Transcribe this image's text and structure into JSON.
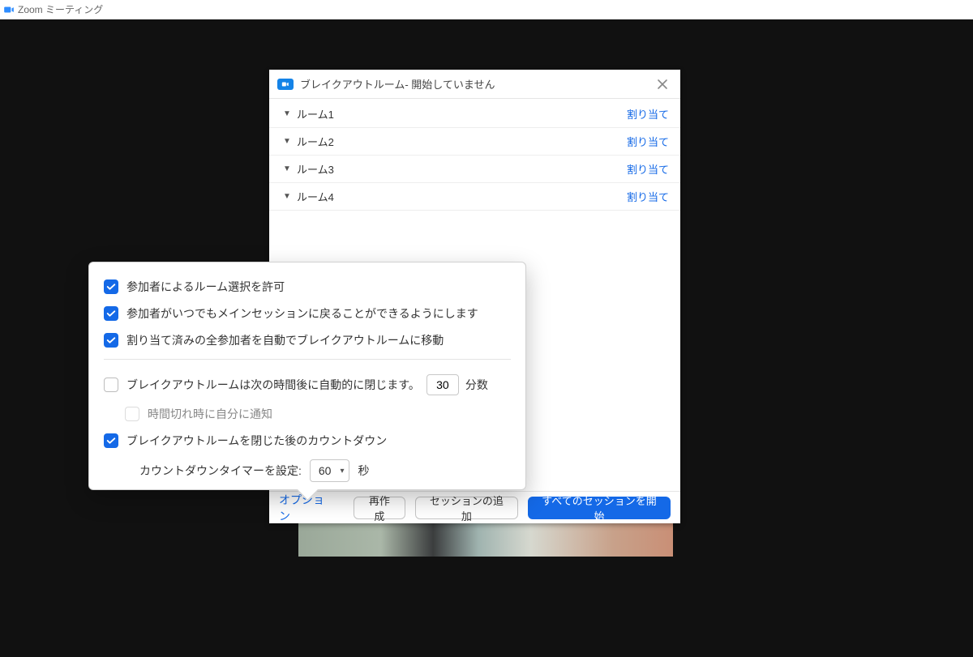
{
  "window": {
    "title": "Zoom ミーティング"
  },
  "breakout": {
    "title": "ブレイクアウトルーム- 開始していません",
    "assign_label": "割り当て",
    "rooms": [
      "ルーム1",
      "ルーム2",
      "ルーム3",
      "ルーム4"
    ],
    "footer": {
      "options": "オプション",
      "recreate": "再作成",
      "add_session": "セッションの追加",
      "start_all": "すべてのセッションを開始"
    }
  },
  "options": {
    "allow_choose": {
      "label": "参加者によるルーム選択を許可",
      "checked": true
    },
    "allow_return": {
      "label": "参加者がいつでもメインセッションに戻ることができるようにします",
      "checked": true
    },
    "auto_move": {
      "label": "割り当て済みの全参加者を自動でブレイクアウトルームに移動",
      "checked": true
    },
    "auto_close": {
      "label": "ブレイクアウトルームは次の時間後に自動的に閉じます。",
      "checked": false,
      "minutes": "30",
      "unit": "分数"
    },
    "notify_me": {
      "label": "時間切れ時に自分に通知",
      "checked": false,
      "disabled": true
    },
    "countdown": {
      "label": "ブレイクアウトルームを閉じた後のカウントダウン",
      "checked": true
    },
    "countdown_set": {
      "label": "カウントダウンタイマーを設定:",
      "seconds": "60",
      "unit": "秒"
    }
  },
  "colors": {
    "accent": "#1469e7"
  }
}
